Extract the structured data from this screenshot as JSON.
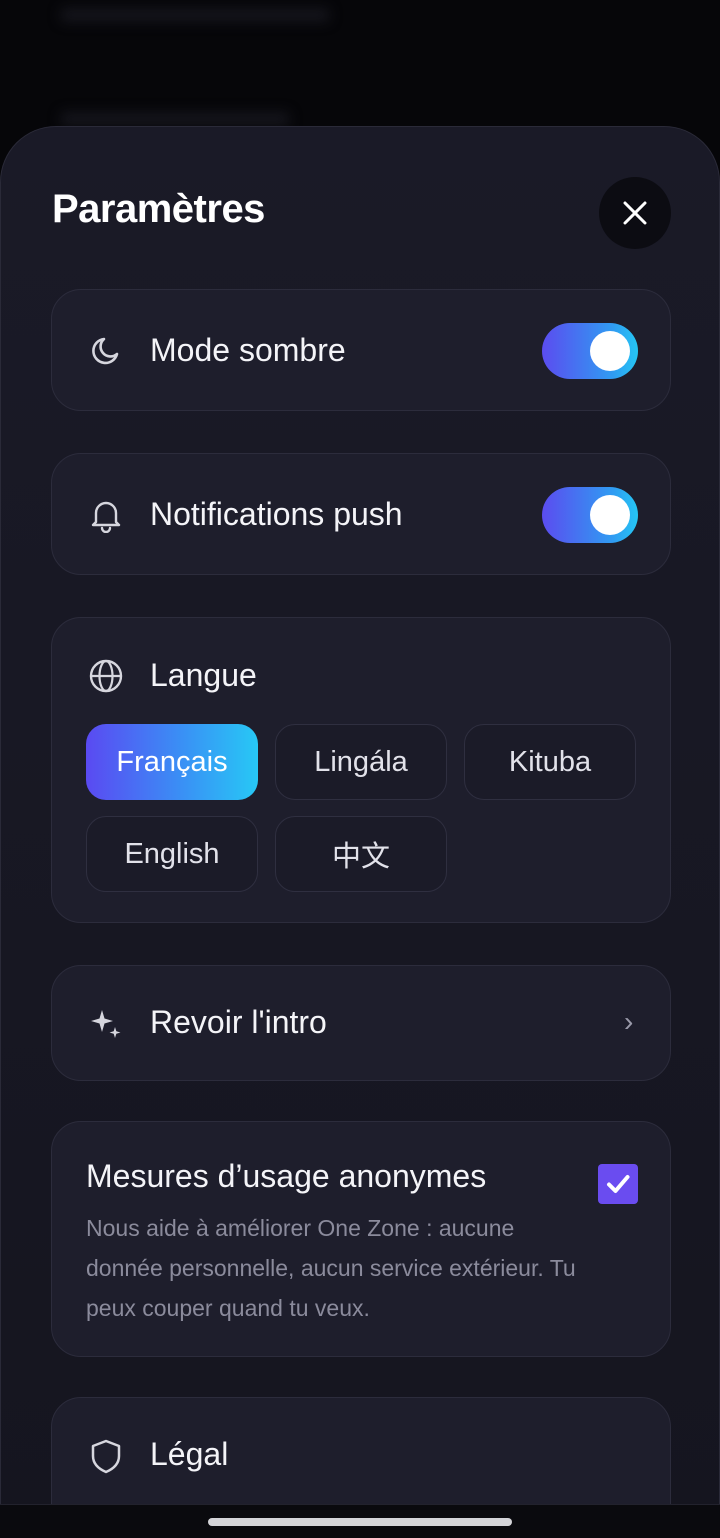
{
  "sheet": {
    "title": "Paramètres",
    "close_icon": "close-icon"
  },
  "settings": {
    "dark_mode": {
      "label": "Mode sombre",
      "icon": "moon-icon",
      "enabled": true
    },
    "push_notifications": {
      "label": "Notifications push",
      "icon": "bell-icon",
      "enabled": true
    },
    "language": {
      "label": "Langue",
      "icon": "globe-icon",
      "selected": "Français",
      "options": [
        "Français",
        "Lingála",
        "Kituba",
        "English",
        "中文"
      ]
    },
    "replay_intro": {
      "label": "Revoir l'intro",
      "icon": "sparkle-icon",
      "chevron": "›"
    },
    "analytics": {
      "label": "Mesures d’usage anonymes",
      "description": "Nous aide à améliorer One Zone : aucune donnée personnelle, aucun service extérieur. Tu peux couper quand tu veux.",
      "checked": true
    },
    "legal": {
      "label": "Légal",
      "icon": "shield-icon"
    }
  },
  "colors": {
    "accent_start": "#5b4cf0",
    "accent_end": "#25c7f4",
    "checkbox": "#6a4cf0",
    "card_bg": "#1e1e2c",
    "sheet_bg": "#1a1a27"
  }
}
